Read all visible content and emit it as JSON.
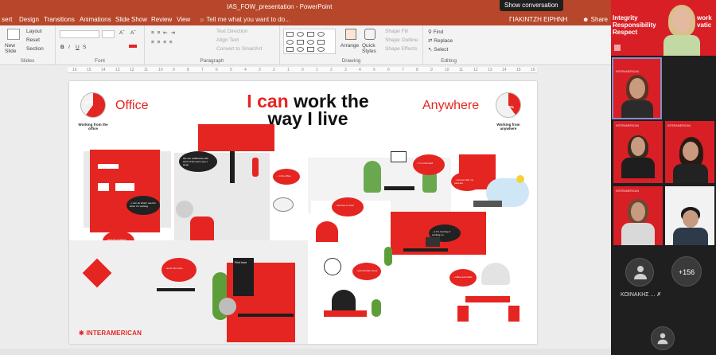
{
  "app": {
    "title": "IAS_FOW_presentation - PowerPoint",
    "show_conversation": "Show conversation",
    "tabs": [
      "sert",
      "Design",
      "Transitions",
      "Animations",
      "Slide Show",
      "Review",
      "View"
    ],
    "tell_me": "Tell me what you want to do...",
    "user": "ΓΙΑΚΙΝΤΖΗ ΕΙΡΗΝΗ",
    "share": "Share"
  },
  "ribbon": {
    "slides": {
      "new_slide": "New Slide",
      "layout": "Layout",
      "reset": "Reset",
      "section": "Section",
      "label": "Slides"
    },
    "font": {
      "bold": "B",
      "italic": "I",
      "underline": "U",
      "strike": "S",
      "label": "Font"
    },
    "paragraph": {
      "text_direction": "Text Direction",
      "align_text": "Align Text",
      "convert_smartart": "Convert to SmartArt",
      "label": "Paragraph"
    },
    "drawing": {
      "arrange": "Arrange",
      "quick_styles": "Quick Styles",
      "shape_fill": "Shape Fill",
      "shape_outline": "Shape Outline",
      "shape_effects": "Shape Effects",
      "label": "Drawing"
    },
    "editing": {
      "find": "Find",
      "replace": "Replace",
      "select": "Select",
      "label": "Editing"
    }
  },
  "ruler": [
    "16",
    "15",
    "14",
    "13",
    "12",
    "11",
    "10",
    "9",
    "8",
    "7",
    "6",
    "5",
    "4",
    "3",
    "2",
    "1",
    "0",
    "1",
    "2",
    "3",
    "4",
    "5",
    "6",
    "7",
    "8",
    "9",
    "10",
    "11",
    "12",
    "13",
    "14",
    "15",
    "16"
  ],
  "slide": {
    "headline_red": "I can",
    "headline_rest": " work the",
    "headline_line2": "way I live",
    "office": "Office",
    "anywhere": "Anywhere",
    "office_pct": "60%",
    "anywhere_pct": "40%",
    "office_pie_fraction": 0.6,
    "anywhere_pie_fraction": 0.4,
    "office_caption": "Working from the office",
    "anywhere_caption": "Working from anywhere",
    "logo": "INTERAMERICAN",
    "bubble_text": {
      "collaborate": "We can collaborate with each of the team very x week",
      "office": "... in the office",
      "focus": "...I can do what I need to when I'm working",
      "thought": "Thought leader",
      "hot": "...and set up laptop",
      "laptop": "...and I can work...",
      "field": "...I'm in the field",
      "sync": "...connect with my partners",
      "prints": "Print here",
      "flex": "...a I'm running or working on",
      "free": "...feel free to work",
      "flexible": "...work flexible hours",
      "coffee": "...coffee and chats",
      "new": "...new ideas"
    },
    "red": "#e52521"
  },
  "teams": {
    "banner_left": "Integrity Responsibility Respect",
    "banner_right": "work vatic",
    "more_count": "+156",
    "participant_name": "ΚΟΙΝΑΚΗΣ ...",
    "tile_label": "INTERAMERICAN"
  }
}
